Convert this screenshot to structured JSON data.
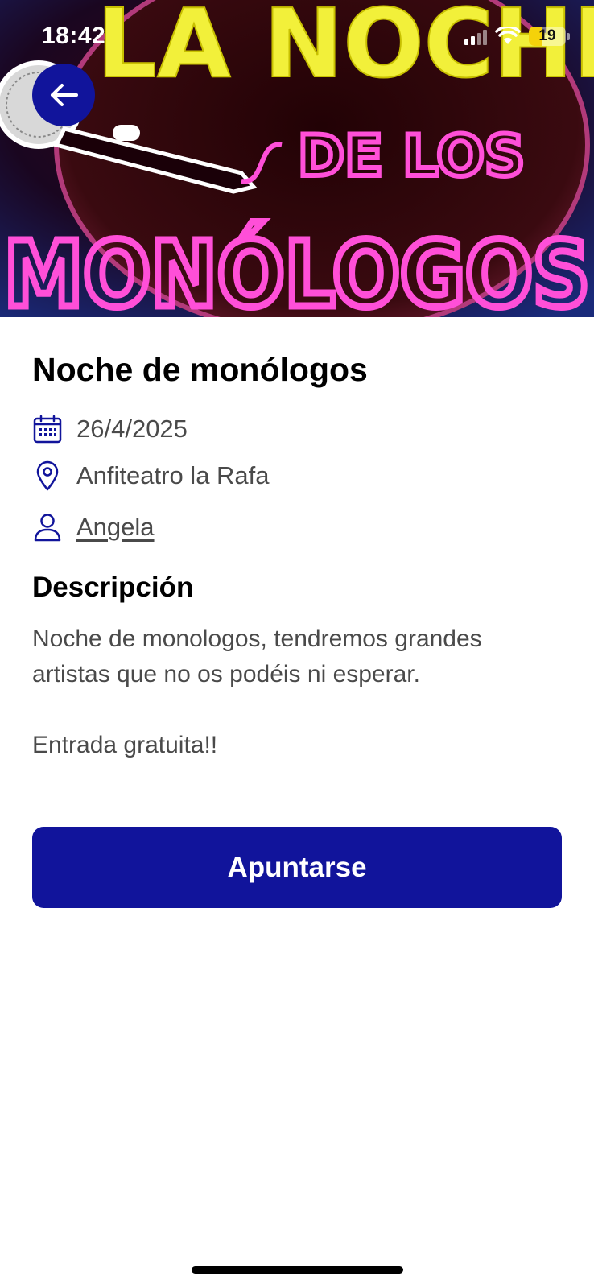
{
  "status_bar": {
    "time": "18:42",
    "battery": "19",
    "battery_level": 0.19,
    "signal_icon": "cellular-signal-icon",
    "wifi_icon": "wifi-icon"
  },
  "hero": {
    "image_icon": "event-poster-image",
    "poster_text": [
      "LA NOCHE",
      "DE LOS",
      "MONÓLOGOS"
    ]
  },
  "back_button": {
    "icon": "arrow-left-icon"
  },
  "event": {
    "title": "Noche de monólogos",
    "date": "26/4/2025",
    "location": "Anfiteatro la Rafa",
    "organizer": "Angela",
    "date_icon": "calendar-icon",
    "location_icon": "location-pin-icon",
    "organizer_icon": "user-icon"
  },
  "description": {
    "heading": "Descripción",
    "text": "Noche de monologos, tendremos grandes artistas que no os podéis ni esperar.\n\nEntrada gratuita!!"
  },
  "actions": {
    "join_label": "Apuntarse"
  },
  "colors": {
    "primary": "#11149b",
    "text_secondary": "#4a4a4a",
    "poster_yellow": "#f2f03a",
    "poster_pink": "#ff4fd8"
  }
}
